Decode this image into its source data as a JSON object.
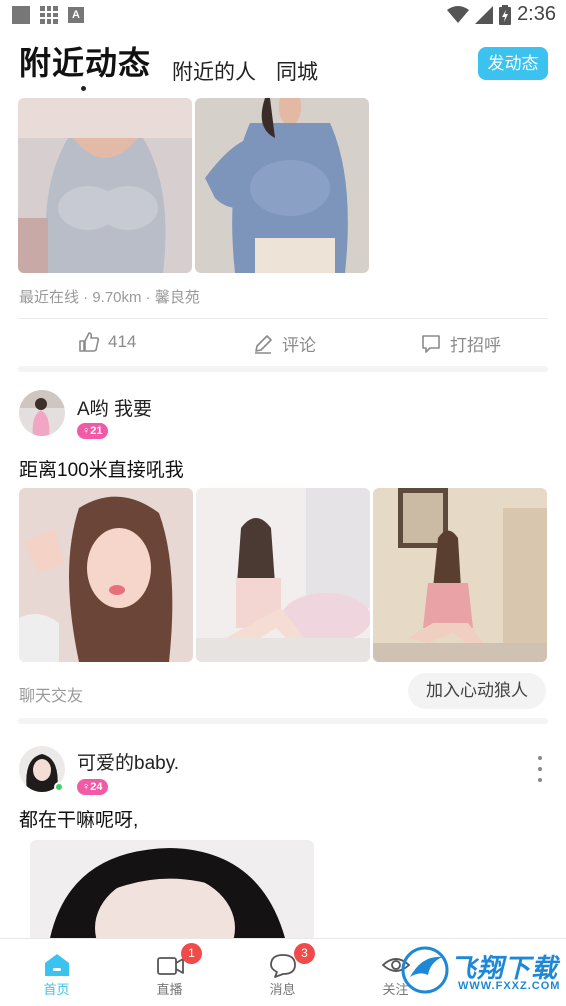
{
  "status_bar": {
    "time": "2:36",
    "icons": [
      "notification-square-icon",
      "grid-icon",
      "a-icon",
      "wifi-icon",
      "signal-icon",
      "battery-icon"
    ]
  },
  "header": {
    "active_tab": "附近动态",
    "tabs": [
      "附近的人",
      "同城"
    ],
    "post_button": "发动态",
    "accent_color": "#3cc2ef"
  },
  "posts": [
    {
      "meta": "最近在线 · 9.70km · 馨良苑",
      "actions": {
        "likes": "414",
        "comment": "评论",
        "greet": "打招呼"
      }
    },
    {
      "user": "A哟   我要",
      "age": "21",
      "text": "距离100米直接吼我",
      "tag": "聊天交友",
      "join_button": "加入心动狼人"
    },
    {
      "user": "可爱的baby.",
      "age": "24",
      "text": "都在干嘛呢呀,"
    }
  ],
  "bottom_nav": [
    {
      "label": "首页",
      "icon": "home-icon",
      "active": true
    },
    {
      "label": "直播",
      "icon": "video-camera-icon",
      "badge": "1"
    },
    {
      "label": "消息",
      "icon": "chat-bubble-icon",
      "badge": "3"
    },
    {
      "label": "关注",
      "icon": "eye-icon"
    }
  ],
  "watermark": {
    "title": "飞翔下载",
    "url": "WWW.FXXZ.COM"
  }
}
